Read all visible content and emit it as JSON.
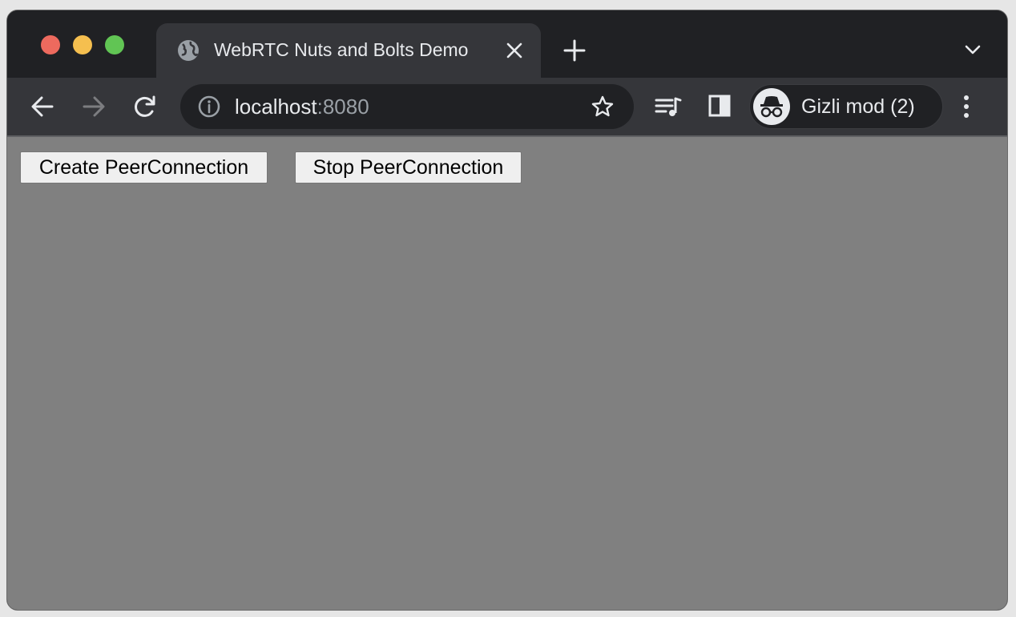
{
  "tab": {
    "title": "WebRTC Nuts and Bolts Demo"
  },
  "address_bar": {
    "host": "localhost",
    "port": ":8080"
  },
  "profile": {
    "label": "Gizli mod (2)"
  },
  "page": {
    "buttons": [
      {
        "label": "Create PeerConnection"
      },
      {
        "label": "Stop PeerConnection"
      }
    ]
  },
  "colors": {
    "page_background": "#808080",
    "button_background": "#efefef",
    "window_chrome": "#202124",
    "toolbar": "#35363a"
  }
}
